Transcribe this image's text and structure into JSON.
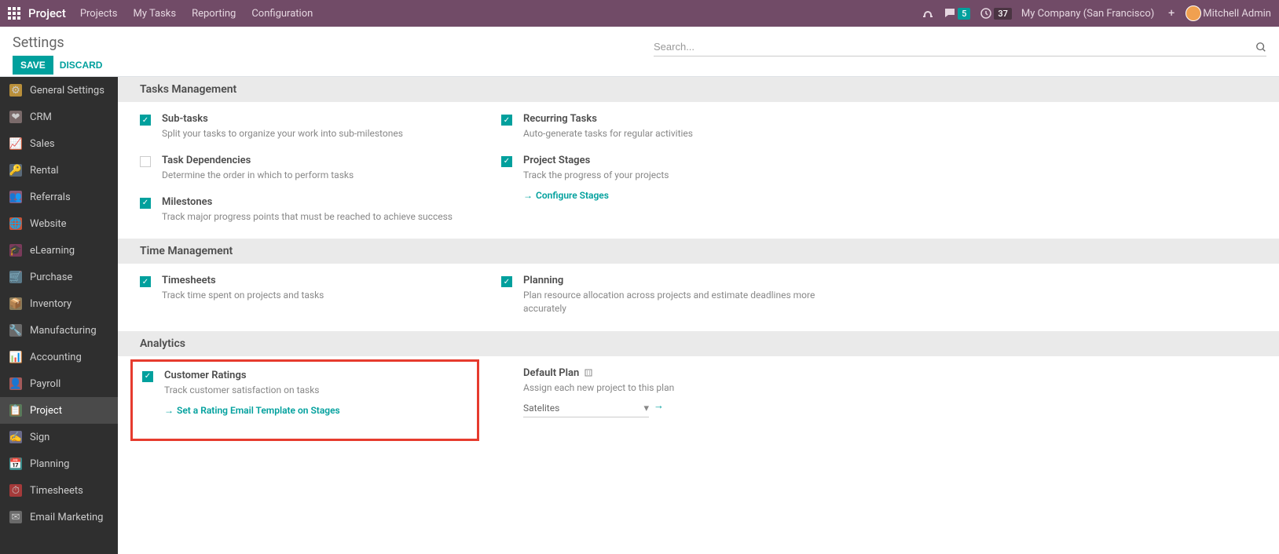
{
  "nav": {
    "app_name": "Project",
    "menu": [
      "Projects",
      "My Tasks",
      "Reporting",
      "Configuration"
    ],
    "messages_count": "5",
    "activities_count": "37",
    "company": "My Company (San Francisco)",
    "user": "Mitchell Admin"
  },
  "page": {
    "title": "Settings",
    "save": "SAVE",
    "discard": "DISCARD",
    "search_placeholder": "Search..."
  },
  "sidebar": {
    "items": [
      {
        "label": "General Settings",
        "icon": "⚙",
        "bg": "#b98f3a"
      },
      {
        "label": "CRM",
        "icon": "🤝",
        "bg": "#7a6a6a"
      },
      {
        "label": "Sales",
        "icon": "📈",
        "bg": "#c55a3a"
      },
      {
        "label": "Rental",
        "icon": "🔑",
        "bg": "#5a6a7a"
      },
      {
        "label": "Referrals",
        "icon": "👥",
        "bg": "#8a5a7a"
      },
      {
        "label": "Website",
        "icon": "🌐",
        "bg": "#c5553a"
      },
      {
        "label": "eLearning",
        "icon": "🎓",
        "bg": "#7a3a5a"
      },
      {
        "label": "Purchase",
        "icon": "🛒",
        "bg": "#5a7a8a"
      },
      {
        "label": "Inventory",
        "icon": "📦",
        "bg": "#8a7a5a"
      },
      {
        "label": "Manufacturing",
        "icon": "🔧",
        "bg": "#6a6a6a"
      },
      {
        "label": "Accounting",
        "icon": "📊",
        "bg": "#c57a3a"
      },
      {
        "label": "Payroll",
        "icon": "👤",
        "bg": "#a55a5a"
      },
      {
        "label": "Project",
        "icon": "📋",
        "bg": "#5a7a5a",
        "active": true
      },
      {
        "label": "Sign",
        "icon": "✍",
        "bg": "#6a6a8a"
      },
      {
        "label": "Planning",
        "icon": "📅",
        "bg": "#3a8a8a"
      },
      {
        "label": "Timesheets",
        "icon": "⏱",
        "bg": "#a53a3a"
      },
      {
        "label": "Email Marketing",
        "icon": "✉",
        "bg": "#6a6a6a"
      }
    ]
  },
  "sections": {
    "tasks": {
      "title": "Tasks Management",
      "subtasks": {
        "title": "Sub-tasks",
        "desc": "Split your tasks to organize your work into sub-milestones",
        "checked": true
      },
      "dependencies": {
        "title": "Task Dependencies",
        "desc": "Determine the order in which to perform tasks",
        "checked": false
      },
      "milestones": {
        "title": "Milestones",
        "desc": "Track major progress points that must be reached to achieve success",
        "checked": true
      },
      "recurring": {
        "title": "Recurring Tasks",
        "desc": "Auto-generate tasks for regular activities",
        "checked": true
      },
      "stages": {
        "title": "Project Stages",
        "desc": "Track the progress of your projects",
        "checked": true,
        "link": "Configure Stages"
      }
    },
    "time": {
      "title": "Time Management",
      "timesheets": {
        "title": "Timesheets",
        "desc": "Track time spent on projects and tasks",
        "checked": true
      },
      "planning": {
        "title": "Planning",
        "desc": "Plan resource allocation across projects and estimate deadlines more accurately",
        "checked": true
      }
    },
    "analytics": {
      "title": "Analytics",
      "ratings": {
        "title": "Customer Ratings",
        "desc": "Track customer satisfaction on tasks",
        "checked": true,
        "link": "Set a Rating Email Template on Stages"
      },
      "plan": {
        "title": "Default Plan",
        "desc": "Assign each new project to this plan",
        "value": "Satelites"
      }
    }
  }
}
